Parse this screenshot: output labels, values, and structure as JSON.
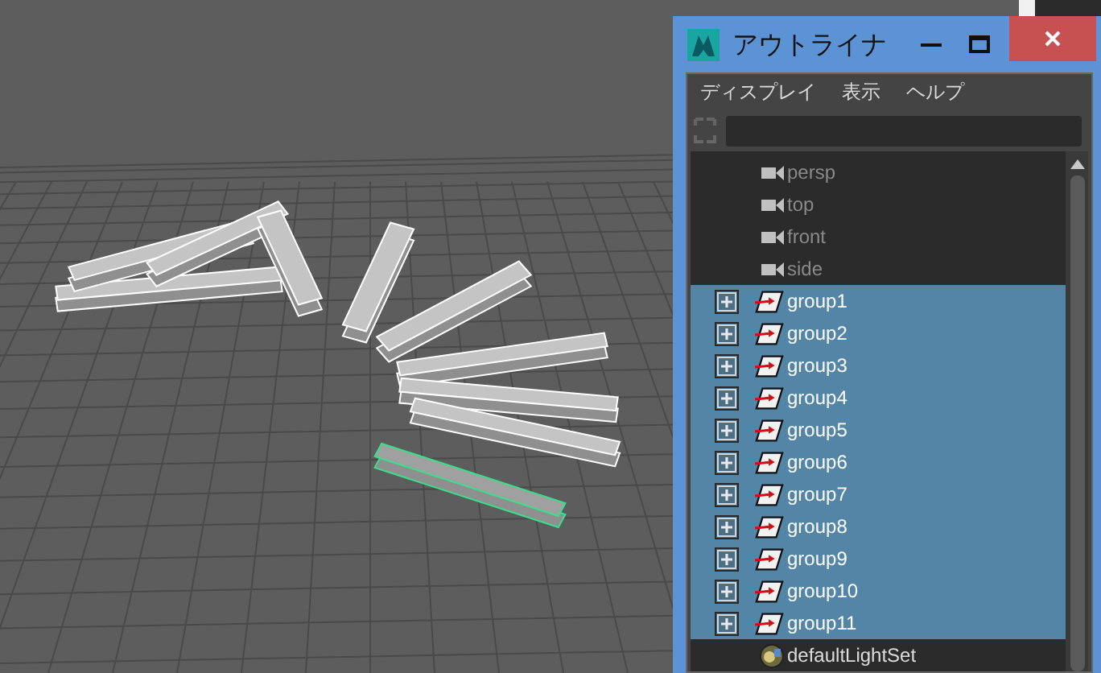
{
  "outliner": {
    "title": "アウトライナ",
    "menu": [
      "ディスプレイ",
      "表示",
      "ヘルプ"
    ],
    "items": [
      {
        "name": "persp",
        "kind": "camera",
        "selected": false
      },
      {
        "name": "top",
        "kind": "camera",
        "selected": false
      },
      {
        "name": "front",
        "kind": "camera",
        "selected": false
      },
      {
        "name": "side",
        "kind": "camera",
        "selected": false
      },
      {
        "name": "group1",
        "kind": "group",
        "selected": true
      },
      {
        "name": "group2",
        "kind": "group",
        "selected": true
      },
      {
        "name": "group3",
        "kind": "group",
        "selected": true
      },
      {
        "name": "group4",
        "kind": "group",
        "selected": true
      },
      {
        "name": "group5",
        "kind": "group",
        "selected": true
      },
      {
        "name": "group6",
        "kind": "group",
        "selected": true
      },
      {
        "name": "group7",
        "kind": "group",
        "selected": true
      },
      {
        "name": "group8",
        "kind": "group",
        "selected": true
      },
      {
        "name": "group9",
        "kind": "group",
        "selected": true
      },
      {
        "name": "group10",
        "kind": "group",
        "selected": true
      },
      {
        "name": "group11",
        "kind": "group",
        "selected": true
      },
      {
        "name": "defaultLightSet",
        "kind": "light_set",
        "selected": false
      }
    ]
  }
}
